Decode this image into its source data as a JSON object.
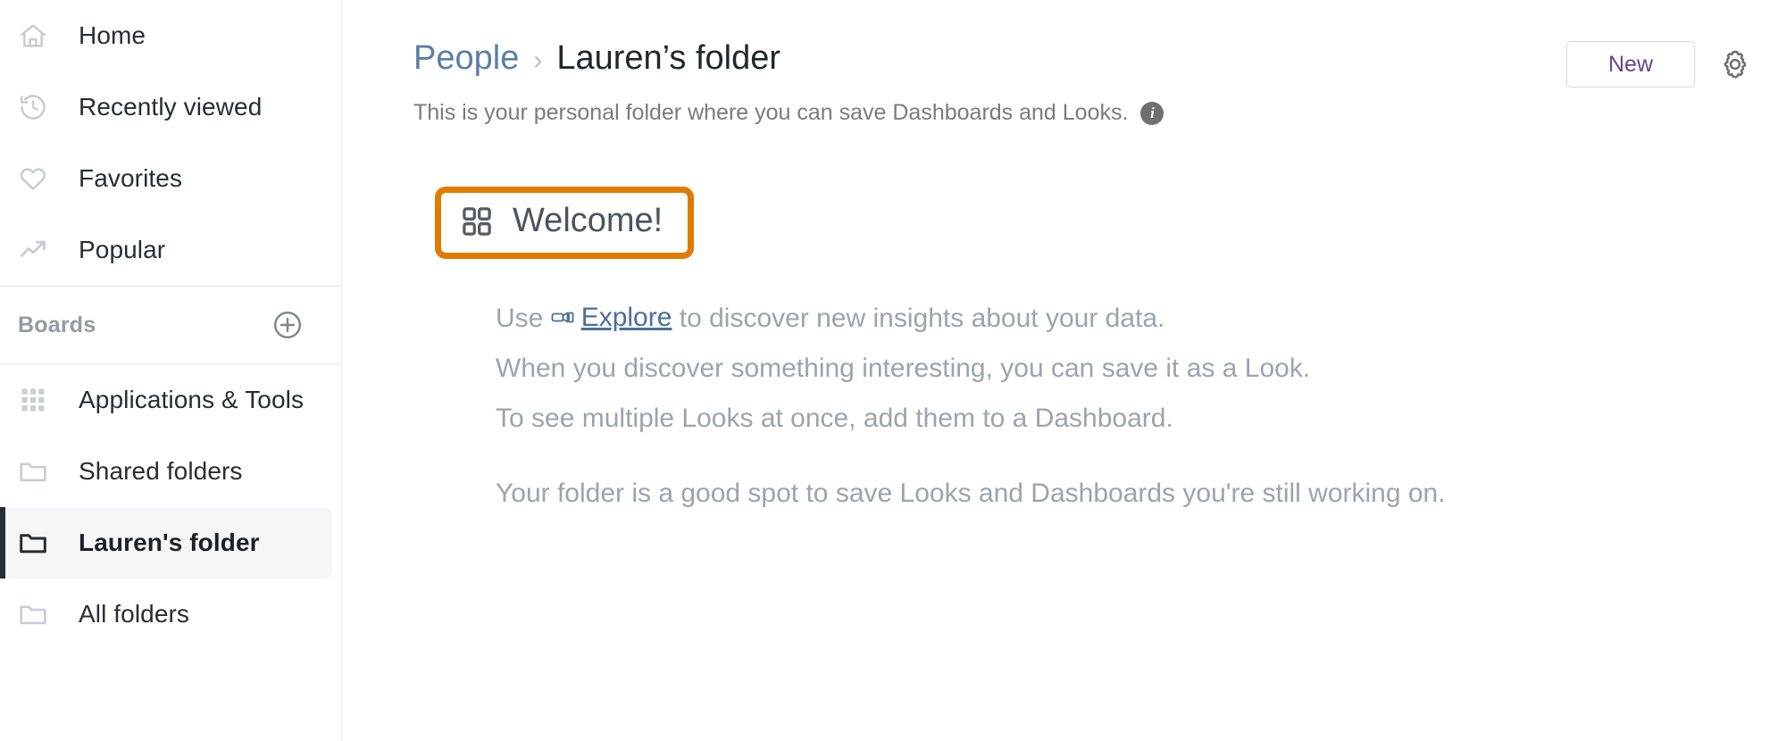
{
  "sidebar": {
    "nav": [
      {
        "label": "Home",
        "icon": "home-icon"
      },
      {
        "label": "Recently viewed",
        "icon": "history-clock-icon"
      },
      {
        "label": "Favorites",
        "icon": "heart-icon"
      },
      {
        "label": "Popular",
        "icon": "trending-up-icon"
      }
    ],
    "section": {
      "title": "Boards",
      "add_icon": "plus-circle-icon"
    },
    "folders": [
      {
        "label": "Applications & Tools",
        "icon": "grid-apps-icon",
        "selected": false
      },
      {
        "label": "Shared folders",
        "icon": "folder-icon",
        "selected": false
      },
      {
        "label": "Lauren's folder",
        "icon": "folder-icon",
        "selected": true
      },
      {
        "label": "All folders",
        "icon": "folder-icon",
        "selected": false
      }
    ]
  },
  "header": {
    "breadcrumb_parent": "People",
    "breadcrumb_separator": "›",
    "breadcrumb_current": "Lauren’s folder",
    "subtitle": "This is your personal folder where you can save Dashboards and Looks.",
    "info_icon_letter": "i",
    "new_button": "New",
    "settings_icon": "gear-icon"
  },
  "content": {
    "welcome_icon": "dashboard-grid-icon",
    "welcome_title": "Welcome!",
    "highlight_color": "#E07B00",
    "line1_prefix": "Use ",
    "explore_icon": "explore-icon",
    "explore_link": "Explore",
    "line1_suffix": " to discover new insights about your data.",
    "line2": "When you discover something interesting, you can save it as a Look.",
    "line3": "To see multiple Looks at once, add them to a Dashboard.",
    "line4": "Your folder is a good spot to save Looks and Dashboards you're still working on."
  }
}
